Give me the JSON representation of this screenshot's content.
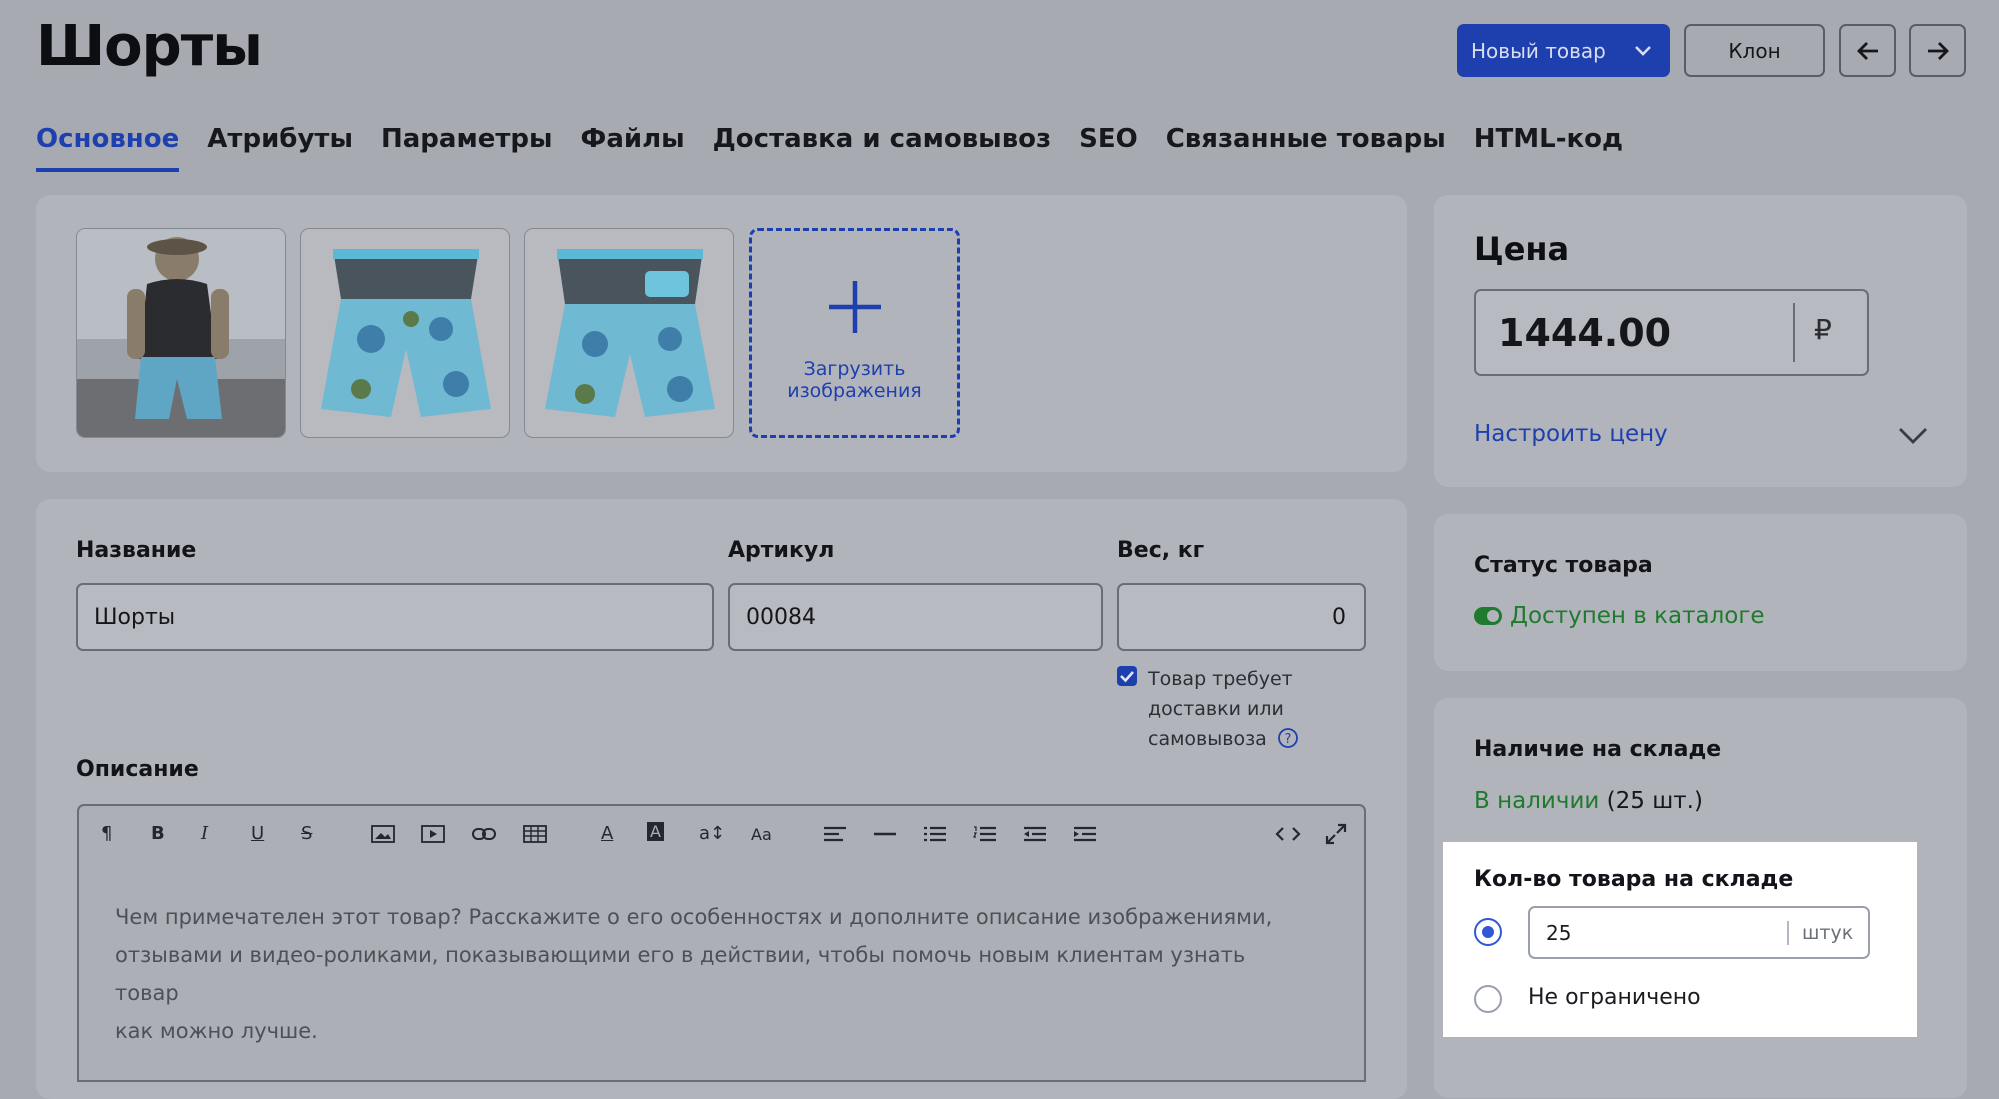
{
  "page_title": "Шорты",
  "header": {
    "new_product_label": "Новый товар",
    "clone_label": "Клон"
  },
  "tabs": [
    {
      "label": "Основное",
      "active": true
    },
    {
      "label": "Атрибуты"
    },
    {
      "label": "Параметры"
    },
    {
      "label": "Файлы"
    },
    {
      "label": "Доставка и самовывоз"
    },
    {
      "label": "SEO"
    },
    {
      "label": "Связанные товары"
    },
    {
      "label": "HTML-код"
    }
  ],
  "images": {
    "upload_label_1": "Загрузить",
    "upload_label_2": "изображения"
  },
  "form": {
    "name_label": "Название",
    "name_value": "Шорты",
    "sku_label": "Артикул",
    "sku_value": "00084",
    "weight_label": "Вес, кг",
    "weight_value": "0",
    "delivery_line1": "Товар требует",
    "delivery_line2": "доставки или",
    "delivery_line3": "самовывоза",
    "delivery_checked": true,
    "description_label": "Описание",
    "description_placeholder_1": "Чем примечателен этот товар? Расскажите о его особенностях и дополните описание изображениями,",
    "description_placeholder_2": "отзывами и видео-роликами, показывающими его в действии, чтобы помочь новым клиентам узнать товар",
    "description_placeholder_3": "как можно лучше."
  },
  "price": {
    "title": "Цена",
    "value": "1444.00",
    "currency": "₽",
    "configure_label": "Настроить цену"
  },
  "status": {
    "title": "Статус товара",
    "value": "Доступен в каталоге"
  },
  "stock": {
    "title": "Наличие на складе",
    "in_stock": "В наличии",
    "count_text": "(25 шт.)",
    "qty_title": "Кол-во товара на складе",
    "qty_value": "25",
    "qty_unit": "штук",
    "unlimited_label": "Не ограничено",
    "selected": "quantity"
  },
  "colors": {
    "accent": "#1e3fae",
    "success": "#1f7a2e",
    "background": "#a8aab2",
    "card": "#b2b4bb"
  }
}
